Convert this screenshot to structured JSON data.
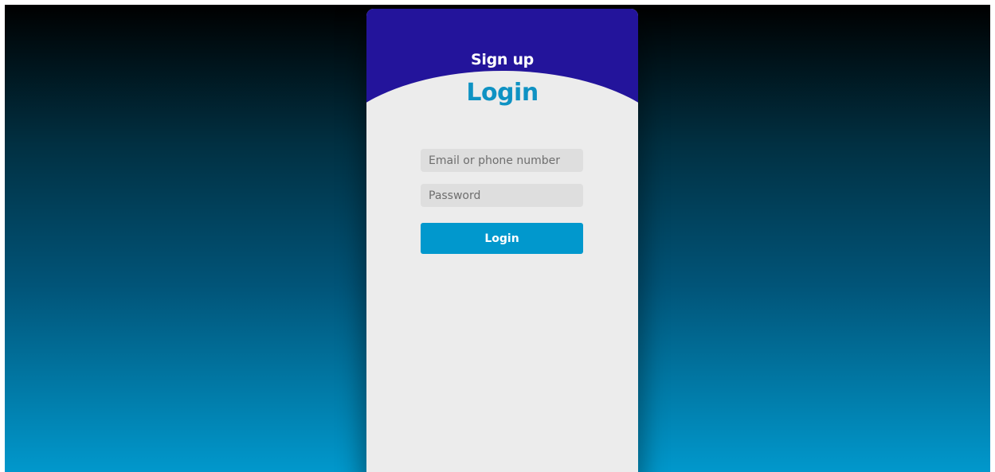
{
  "tabs": {
    "signup_label": "Sign up",
    "login_title": "Login"
  },
  "form": {
    "email_placeholder": "Email or phone number",
    "password_placeholder": "Password",
    "submit_label": "Login"
  },
  "colors": {
    "header": "#23149b",
    "title": "#0f92c3",
    "button": "#0198cd",
    "card": "#ececec",
    "input": "#dedede",
    "background_top": "#000000",
    "background_bottom": "#0198cc"
  }
}
